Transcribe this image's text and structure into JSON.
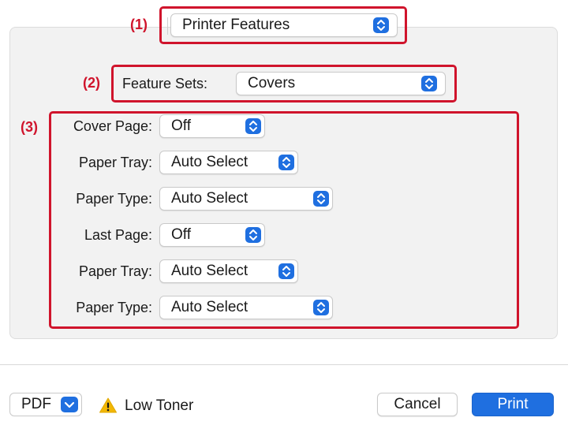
{
  "callouts": {
    "c1": "(1)",
    "c2": "(2)",
    "c3": "(3)"
  },
  "panel_select": {
    "value": "Printer Features"
  },
  "feature_sets": {
    "label": "Feature Sets:",
    "value": "Covers"
  },
  "options": [
    {
      "label": "Cover Page:",
      "value": "Off"
    },
    {
      "label": "Paper Tray:",
      "value": "Auto Select"
    },
    {
      "label": "Paper Type:",
      "value": "Auto Select"
    },
    {
      "label": "Last Page:",
      "value": "Off"
    },
    {
      "label": "Paper Tray:",
      "value": "Auto Select"
    },
    {
      "label": "Paper Type:",
      "value": "Auto Select"
    }
  ],
  "footer": {
    "pdf_label": "PDF",
    "warning_text": "Low Toner",
    "cancel_label": "Cancel",
    "print_label": "Print"
  },
  "colors": {
    "accent": "#1f6fe0",
    "callout": "#d0142c",
    "warning": "#f2b705"
  },
  "icons": {
    "stepper": "up-down-chevron-icon",
    "pdf_menu": "chevron-down-icon",
    "warning": "warning-triangle-icon"
  }
}
